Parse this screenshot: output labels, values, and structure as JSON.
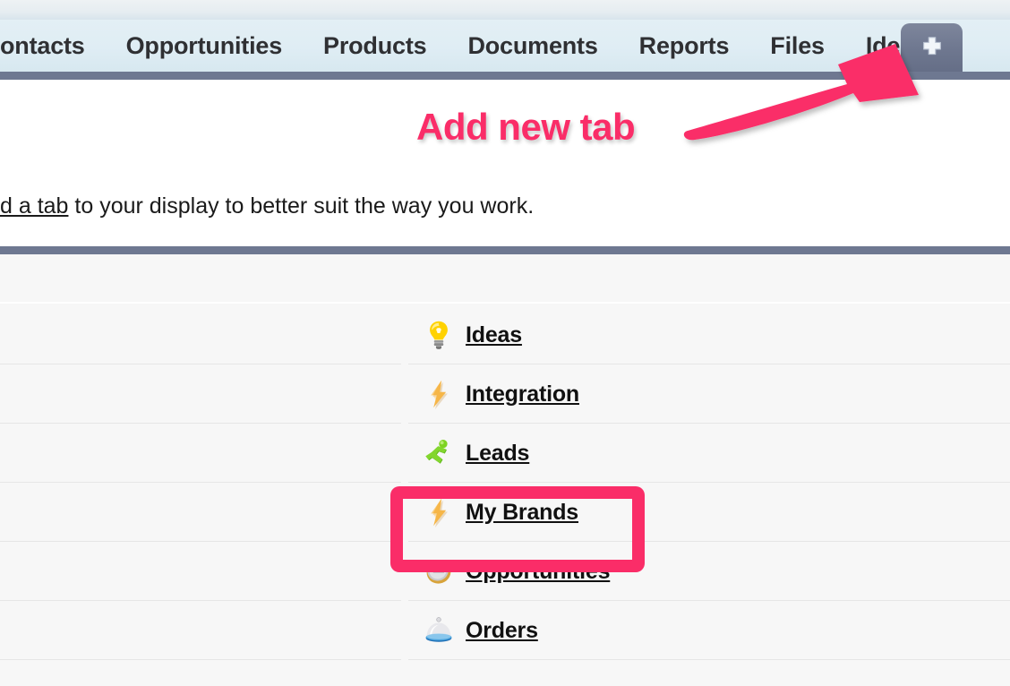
{
  "navigation": {
    "tabs": [
      {
        "label": "ontacts"
      },
      {
        "label": "Opportunities"
      },
      {
        "label": "Products"
      },
      {
        "label": "Documents"
      },
      {
        "label": "Reports"
      },
      {
        "label": "Files"
      },
      {
        "label": "Ideas"
      }
    ],
    "add_tab_button": {
      "icon": "plus-icon",
      "label": "+"
    }
  },
  "intro": {
    "link_text": "d a tab",
    "rest_text": " to your display to better suit the way you work."
  },
  "tab_list": {
    "items": [
      {
        "label": "Ideas",
        "icon": "lightbulb-icon"
      },
      {
        "label": "Integration",
        "icon": "lightning-bolt-icon"
      },
      {
        "label": "Leads",
        "icon": "running-person-icon"
      },
      {
        "label": "My Brands",
        "icon": "lightning-bolt-icon",
        "highlighted": true
      },
      {
        "label": "Opportunities",
        "icon": "coin-crown-icon"
      },
      {
        "label": "Orders",
        "icon": "service-bell-icon"
      }
    ]
  },
  "annotations": {
    "caption": "Add new tab",
    "arrow": "arrow-pointing-to-add-tab",
    "highlight": "my-brands-highlight"
  },
  "colors": {
    "accent_pink": "#fa2d68",
    "bar_slate": "#6e7891",
    "tabbar_blue": "#dfedf4",
    "panel_grey": "#f7f7f7"
  }
}
